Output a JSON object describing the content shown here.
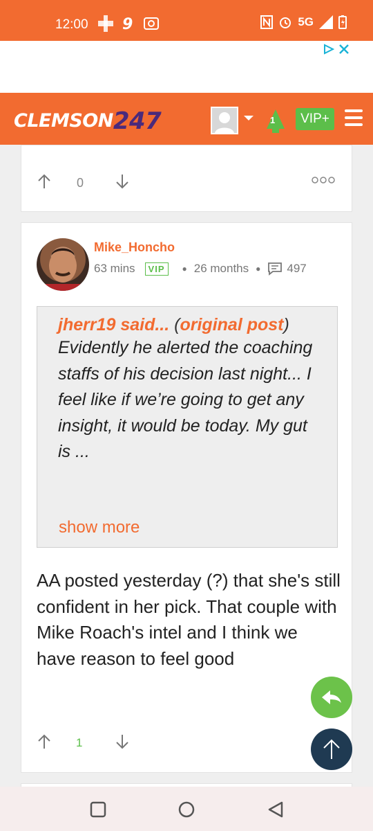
{
  "status_bar": {
    "time": "12:00",
    "network": "5G"
  },
  "header": {
    "logo_text": "CLEMSON",
    "logo_number": "247",
    "notification_count": "1",
    "vip_label": "VIP+"
  },
  "previous_post": {
    "vote_count": "0"
  },
  "post": {
    "username": "Mike_Honcho",
    "time_ago": "63 mins",
    "badge": "VIP",
    "membership": "26 months",
    "post_count": "497",
    "quote": {
      "author": "jherr19 said...",
      "open_paren": " (",
      "link": "original post",
      "close_paren": ")",
      "text": "Evidently he alerted the coaching staffs of his decision last night... I feel like if we’re going to get any insight, it would be today. My gut is ...",
      "show_more": "show more"
    },
    "body": "AA posted yesterday (?) that she's still confident in her pick. That couple with Mike Roach's intel and I think we have reason to feel good",
    "vote_count": "1"
  },
  "colors": {
    "brand_orange": "#f26b30",
    "brand_purple": "#4b2a7b",
    "accent_green": "#5cbe4a",
    "fab_dark": "#1f3a52"
  }
}
